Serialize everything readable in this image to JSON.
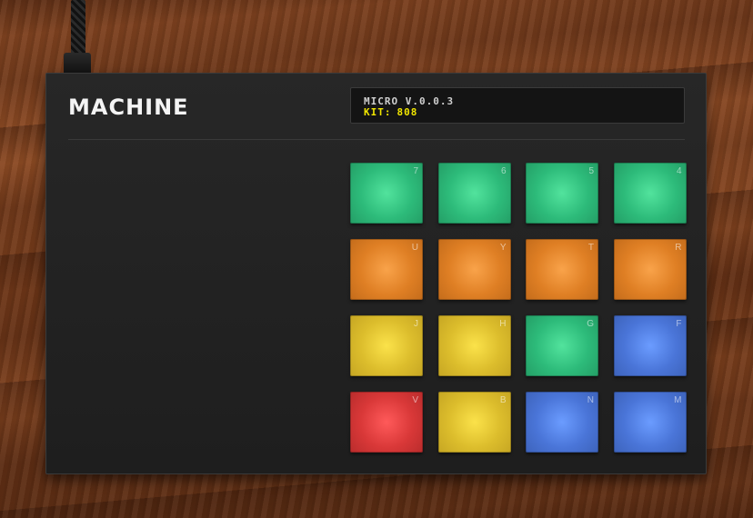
{
  "brand": {
    "logo_text": "MACHINE"
  },
  "screen": {
    "line1": "MICRO V.0.0.3",
    "kit_label": "KIT:",
    "kit_value": "808"
  },
  "colors": {
    "green": "#2dbb7a",
    "orange": "#df7f24",
    "yellow": "#dcbd2c",
    "blue": "#4a75d8",
    "red": "#d93838",
    "display_text": "#f1e600"
  },
  "pads": [
    {
      "key": "7",
      "color": "green"
    },
    {
      "key": "6",
      "color": "green"
    },
    {
      "key": "5",
      "color": "green"
    },
    {
      "key": "4",
      "color": "green"
    },
    {
      "key": "U",
      "color": "orange"
    },
    {
      "key": "Y",
      "color": "orange"
    },
    {
      "key": "T",
      "color": "orange"
    },
    {
      "key": "R",
      "color": "orange"
    },
    {
      "key": "J",
      "color": "yellow"
    },
    {
      "key": "H",
      "color": "yellow"
    },
    {
      "key": "G",
      "color": "green"
    },
    {
      "key": "F",
      "color": "blue"
    },
    {
      "key": "V",
      "color": "red"
    },
    {
      "key": "B",
      "color": "yellow"
    },
    {
      "key": "N",
      "color": "blue"
    },
    {
      "key": "M",
      "color": "blue"
    }
  ]
}
